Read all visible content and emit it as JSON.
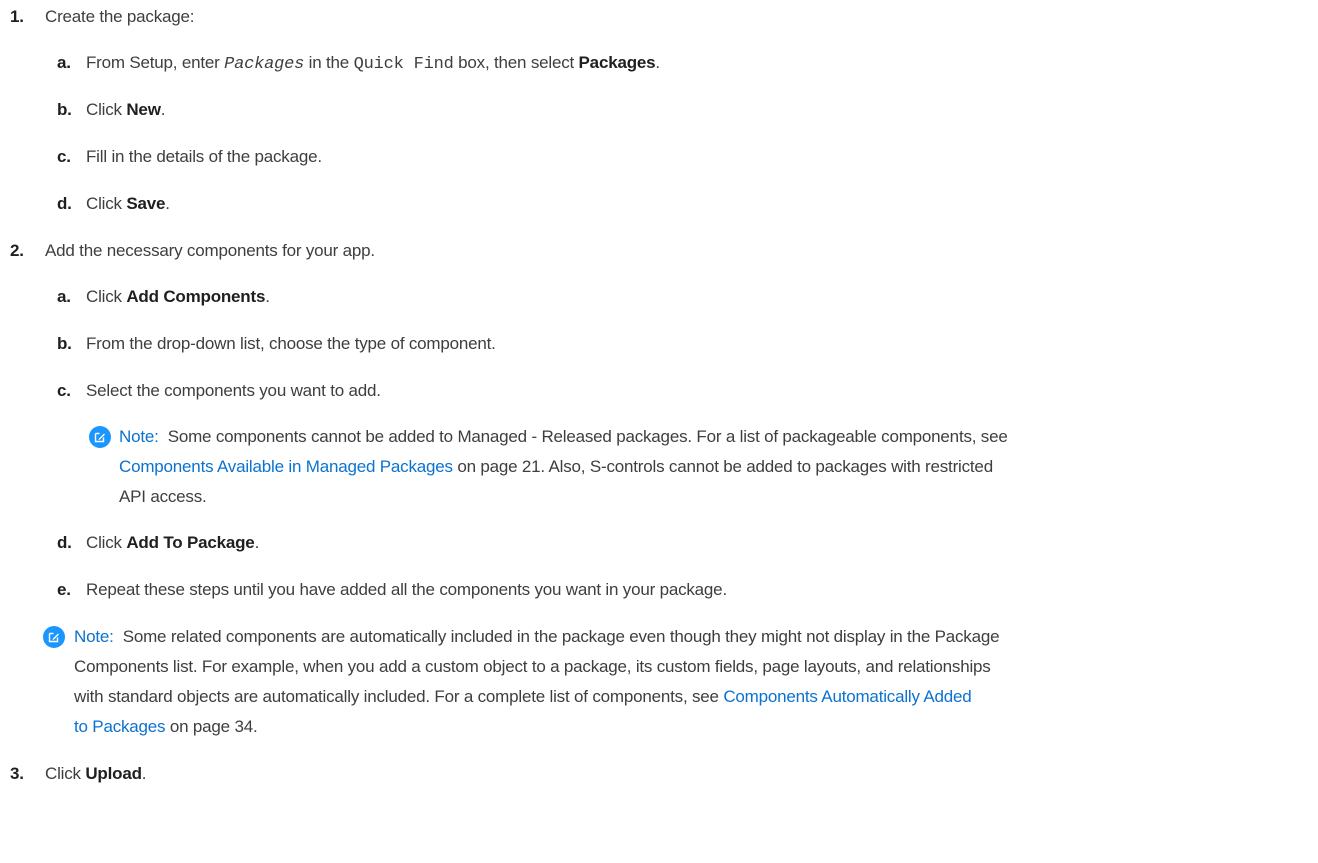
{
  "steps": [
    {
      "num": "1.",
      "text": "Create the package:",
      "substeps": [
        {
          "letter": "a.",
          "pre": "From Setup, enter ",
          "code_italic": "Packages",
          "mid": " in the ",
          "code": "Quick Find",
          "post": " box, then select ",
          "bold": "Packages",
          "end": "."
        },
        {
          "letter": "b.",
          "pre": "Click ",
          "bold": "New",
          "end": "."
        },
        {
          "letter": "c.",
          "text": "Fill in the details of the package."
        },
        {
          "letter": "d.",
          "pre": "Click ",
          "bold": "Save",
          "end": "."
        }
      ]
    },
    {
      "num": "2.",
      "text": "Add the necessary components for your app.",
      "substeps": [
        {
          "letter": "a.",
          "pre": "Click ",
          "bold": "Add Components",
          "end": "."
        },
        {
          "letter": "b.",
          "text": "From the drop-down list, choose the type of component."
        },
        {
          "letter": "c.",
          "text": "Select the components you want to add."
        },
        {
          "letter": "d.",
          "pre": "Click ",
          "bold": "Add To Package",
          "end": "."
        },
        {
          "letter": "e.",
          "text": "Repeat these steps until you have added all the components you want in your package."
        }
      ]
    },
    {
      "num": "3.",
      "pre": "Click ",
      "bold": "Upload",
      "end": "."
    }
  ],
  "note1": {
    "label": "Note:",
    "line1": "Some components cannot be added to Managed - Released packages. For a list of packageable components, see",
    "link": "Components Available in Managed Packages",
    "line2_rest": " on page 21. Also, S-controls cannot be added to packages with restricted",
    "line3": "API access."
  },
  "note2": {
    "label": "Note:",
    "line1": "Some related components are automatically included in the package even though they might not display in the Package",
    "line2": "Components list. For example, when you add a custom object to a package, its custom fields, page layouts, and relationships",
    "line3_pre": "with standard objects are automatically included. For a complete list of components, see ",
    "link_part1": "Components Automatically Added",
    "link_part2": "to Packages",
    "line4_rest": " on page 34."
  },
  "icons": {
    "note": "edit-pencil-icon",
    "accent": "#1b96ff",
    "link_color": "#0b72d0"
  }
}
